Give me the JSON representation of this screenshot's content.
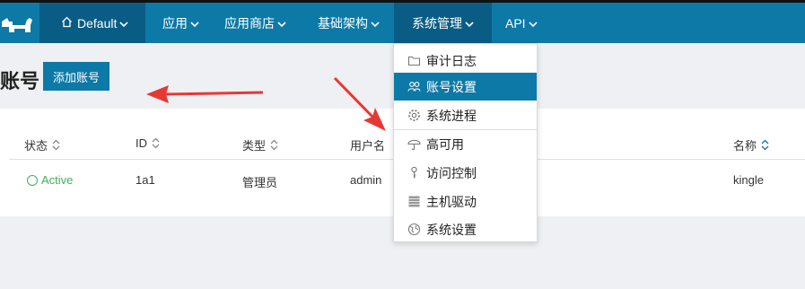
{
  "nav": {
    "environment": "Default",
    "items": [
      {
        "label": "应用"
      },
      {
        "label": "应用商店"
      },
      {
        "label": "基础架构"
      },
      {
        "label": "系统管理"
      },
      {
        "label": "API"
      }
    ]
  },
  "page": {
    "title": "账号",
    "add_button": "添加账号"
  },
  "table": {
    "headers": [
      "状态",
      "ID",
      "类型",
      "用户名",
      "名称"
    ],
    "rows": [
      {
        "status": "Active",
        "id": "1a1",
        "type": "管理员",
        "username": "admin",
        "name": "kingle"
      }
    ]
  },
  "dropdown": {
    "items": [
      {
        "label": "审计日志",
        "icon": "folder-icon"
      },
      {
        "label": "账号设置",
        "icon": "users-icon"
      },
      {
        "label": "系统进程",
        "icon": "gear-icon"
      },
      {
        "label": "高可用",
        "icon": "umbrella-icon"
      },
      {
        "label": "访问控制",
        "icon": "key-icon"
      },
      {
        "label": "主机驱动",
        "icon": "server-icon"
      },
      {
        "label": "系统设置",
        "icon": "globe-icon"
      }
    ]
  },
  "colors": {
    "nav_bg": "#0d79a6",
    "nav_active": "#095d85",
    "status_green": "#3eb157",
    "annotation_arrow": "#e53935"
  }
}
